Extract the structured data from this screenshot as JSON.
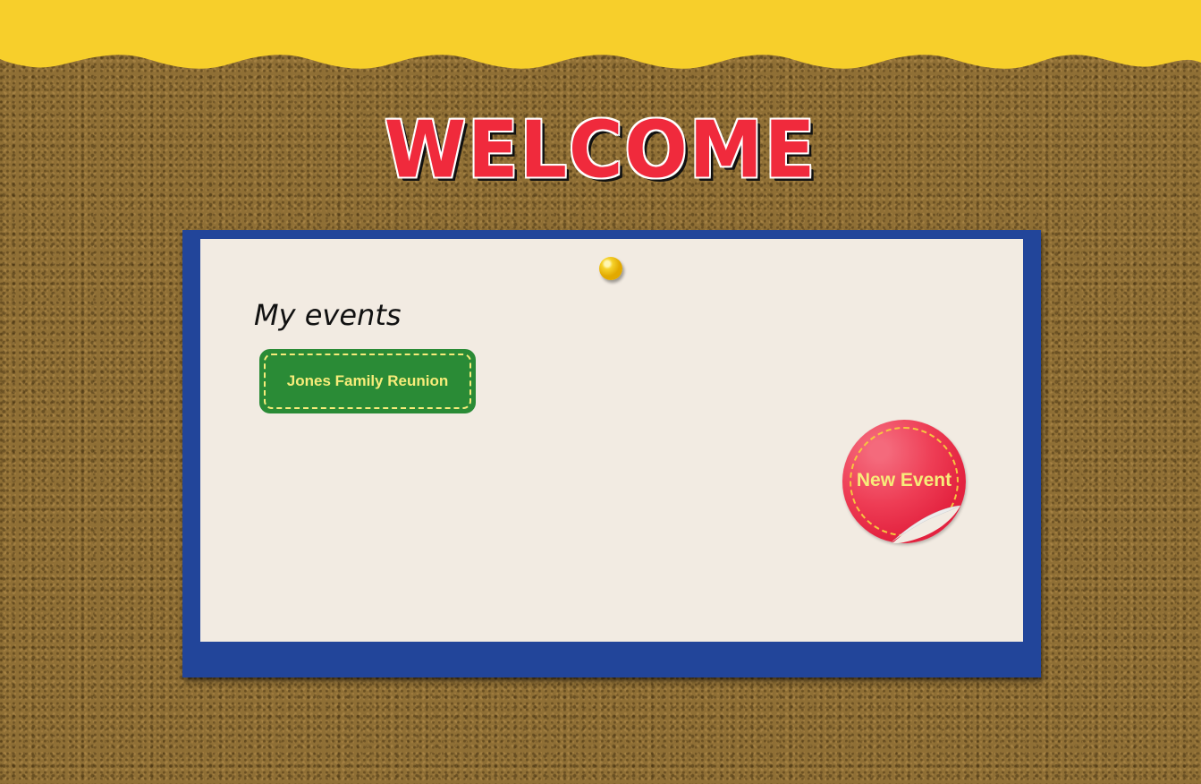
{
  "header": {
    "title": "WELCOME"
  },
  "main": {
    "section_title": "My events",
    "events": [
      {
        "label": "Jones Family Reunion"
      }
    ],
    "new_event_label": "New Event"
  },
  "colors": {
    "banner": "#f7cf2b",
    "title_red": "#f02a3c",
    "board_blue": "#22459a",
    "paper": "#f2ebe2",
    "event_green": "#2a8b36",
    "label_yellow": "#f7ec7a",
    "sticker_red": "#ee3d55",
    "pin_yellow": "#f6d22a"
  },
  "icons": {
    "pin": "pushpin-icon"
  }
}
